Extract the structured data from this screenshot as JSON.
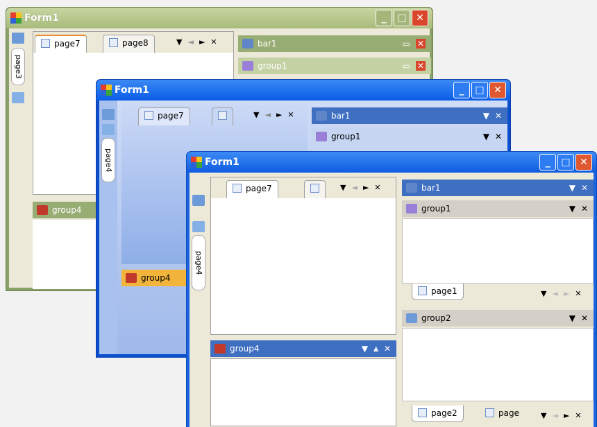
{
  "windows": [
    {
      "theme": "olive",
      "title": "Form1",
      "caption_buttons": {
        "minimize": "_",
        "maximize": "□",
        "close": "✕"
      },
      "side_tab": "page3",
      "doc_tabs": [
        {
          "label": "page7",
          "active": true
        },
        {
          "label": "page8",
          "active": false
        }
      ],
      "tab_nav": {
        "menu": "▼",
        "prev": "◄",
        "next": "►",
        "close": "✕"
      },
      "right_bars": [
        {
          "label": "bar1"
        },
        {
          "label": "group1"
        }
      ],
      "bar_buttons": {
        "restore": "▭",
        "close": "✕"
      },
      "bottom_group": "group4"
    },
    {
      "theme": "blue",
      "title": "Form1",
      "caption_buttons": {
        "minimize": "_",
        "maximize": "□",
        "close": "✕"
      },
      "side_tab": "page4",
      "doc_tabs": [
        {
          "label": "page7",
          "active": true
        },
        {
          "label": "",
          "active": false
        }
      ],
      "tab_nav": {
        "menu": "▼",
        "prev": "◄",
        "next": "►",
        "close": "✕"
      },
      "right_bars": [
        {
          "label": "bar1"
        },
        {
          "label": "group1"
        }
      ],
      "bar_buttons": {
        "menu": "▼",
        "close": "✕"
      },
      "bottom_group": "group4"
    },
    {
      "theme": "classic",
      "title": "Form1",
      "caption_buttons": {
        "minimize": "_",
        "maximize": "□",
        "close": "✕"
      },
      "side_tab": "page4",
      "doc_tabs": [
        {
          "label": "page7",
          "active": true
        },
        {
          "label": "",
          "active": false
        }
      ],
      "tab_nav": {
        "menu": "▼",
        "prev": "◄",
        "next": "►",
        "close": "✕"
      },
      "bar1": {
        "label": "bar1",
        "buttons": {
          "menu": "▼",
          "close": "✕"
        }
      },
      "group1": {
        "label": "group1",
        "buttons": {
          "menu": "▼",
          "close": "✕"
        },
        "tabs": [
          {
            "label": "page1"
          }
        ],
        "nav": {
          "menu": "▼",
          "prev": "◄",
          "next": "►",
          "close": "✕"
        }
      },
      "group2": {
        "label": "group2",
        "buttons": {
          "menu": "▼",
          "close": "✕"
        },
        "tabs": [
          {
            "label": "page2"
          },
          {
            "label": "page"
          }
        ],
        "nav": {
          "menu": "▼",
          "prev": "◄",
          "next": "►",
          "close": "✕"
        }
      },
      "group4": {
        "label": "group4",
        "buttons": {
          "menu": "▼",
          "collapse": "⩓",
          "close": "✕"
        }
      }
    }
  ],
  "colors": {
    "olive_title": "#b5c58c",
    "olive_frame": "#8aa069",
    "blue_title": "#0a5ce6",
    "blue_frame": "#0c4fce",
    "classic_title": "#1b64e0",
    "close_red": "#d9462c",
    "bar_dark_blue": "#3f6fc1",
    "group_header_tan": "#d4d0c8"
  }
}
